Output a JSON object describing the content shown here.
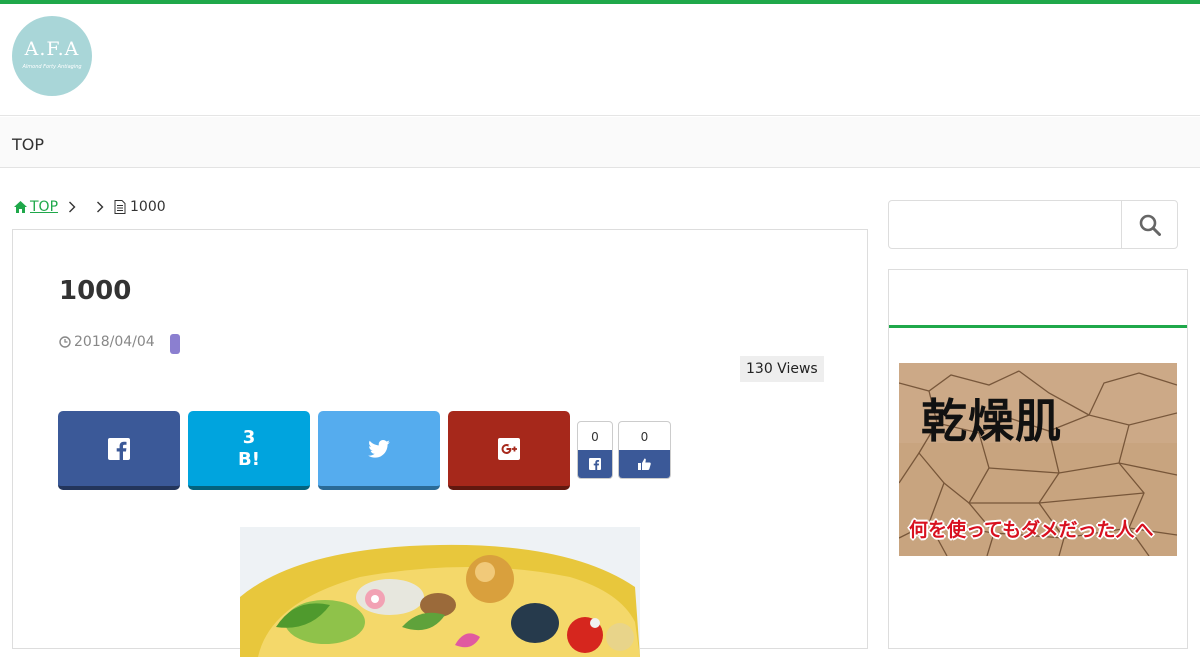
{
  "site": {
    "logo_text": "A.F.A",
    "logo_subtext": "Almond Forty Antiaging"
  },
  "nav": {
    "items": [
      {
        "label": "TOP"
      }
    ]
  },
  "breadcrumb": {
    "home_label": "TOP",
    "current": "1000"
  },
  "article": {
    "title": "1000",
    "date": "2018/04/04",
    "views": "130 Views",
    "share": {
      "hatena_count": "3",
      "hatena_label": "B!",
      "facebook_share_count": "0",
      "facebook_like_count": "0"
    }
  },
  "sidebar": {
    "search": {
      "placeholder": ""
    },
    "ad": {
      "title": "乾燥肌",
      "subtitle": "何を使ってもダメだった人へ"
    }
  },
  "colors": {
    "accent": "#1fa84a",
    "facebook": "#3b5998",
    "hatena": "#00a4de",
    "twitter": "#55acee",
    "googleplus": "#a6281b",
    "category_badge": "#8b7fd0"
  },
  "icons": {
    "breadcrumb_home": "home-icon",
    "breadcrumb_page": "document-icon",
    "date": "clock-icon",
    "search": "search-icon"
  }
}
